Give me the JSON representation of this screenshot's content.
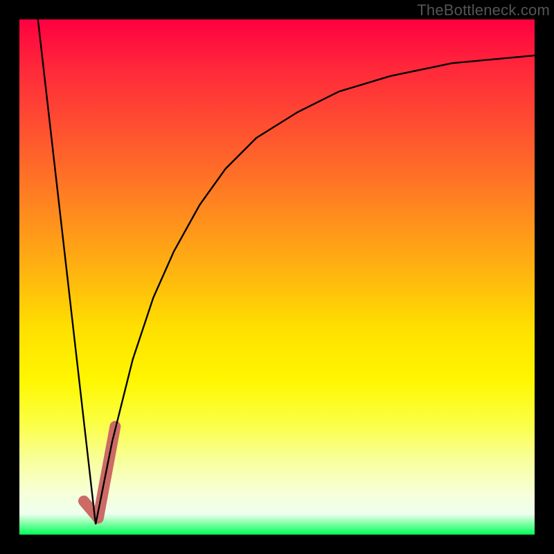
{
  "watermark": "TheBottleneck.com",
  "chart_data": {
    "type": "line",
    "title": "",
    "xlabel": "",
    "ylabel": "",
    "xlim": [
      0,
      100
    ],
    "ylim": [
      0,
      100
    ],
    "grid": false,
    "legend": false,
    "series": [
      {
        "name": "left-stroke",
        "color": "#000000",
        "width": 2,
        "x": [
          3.6,
          14.8
        ],
        "values": [
          100,
          2
        ]
      },
      {
        "name": "main-curve",
        "color": "#000000",
        "width": 2,
        "x": [
          14.8,
          18,
          22,
          26,
          30,
          35,
          40,
          46,
          54,
          62,
          72,
          84,
          100
        ],
        "values": [
          2,
          18,
          34,
          46,
          55,
          64,
          71,
          77,
          82,
          86,
          89,
          91.5,
          93
        ]
      },
      {
        "name": "highlight-tick",
        "color": "#cc6a66",
        "width": 11,
        "linecap": "round",
        "x": [
          12.5,
          15.3,
          18.6
        ],
        "values": [
          6.5,
          3.2,
          21
        ]
      }
    ],
    "background_gradient": {
      "top": "#ff0040",
      "bottom": "#00ff55"
    }
  }
}
